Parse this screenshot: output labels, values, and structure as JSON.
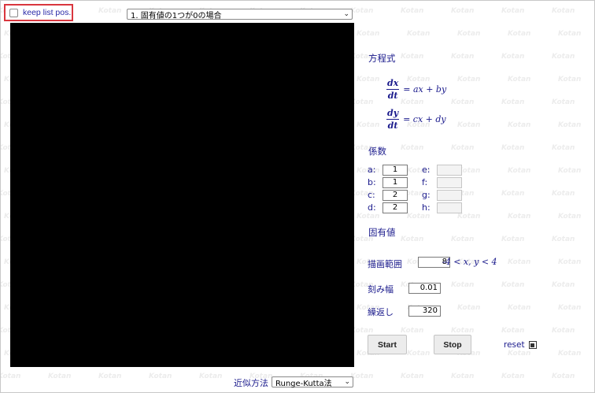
{
  "watermark": {
    "text": "Kotan"
  },
  "keep_list": {
    "label": "keep list pos.",
    "checked": false
  },
  "list_select": {
    "value": "1. 固有値の1つが0の場合"
  },
  "equations": {
    "heading": "方程式",
    "eq1": {
      "num": "dx",
      "den": "dt",
      "rhs": "= ax + by"
    },
    "eq2": {
      "num": "dy",
      "den": "dt",
      "rhs": "= cx + dy"
    }
  },
  "coefficients": {
    "heading": "係数",
    "labels": {
      "a": "a:",
      "b": "b:",
      "c": "c:",
      "d": "d:",
      "e": "e:",
      "f": "f:",
      "g": "g:",
      "h": "h:"
    },
    "values": {
      "a": "1",
      "b": "1",
      "c": "2",
      "d": "2",
      "e": "",
      "f": "",
      "g": "",
      "h": ""
    }
  },
  "eigen": {
    "heading": "固有値"
  },
  "range": {
    "label": "描画範囲",
    "value": "8",
    "text": "-4 < x, y < 4"
  },
  "step": {
    "label": "刻み幅",
    "value": "0.01"
  },
  "repeat": {
    "label": "繰返し",
    "value": "320"
  },
  "buttons": {
    "start": "Start",
    "stop": "Stop"
  },
  "reset": {
    "label": "reset",
    "checked": true
  },
  "method": {
    "label": "近似方法",
    "value": "Runge-Kutta法"
  },
  "colors": {
    "canvas": "#000000",
    "text": "#1a1a8c",
    "highlight_border": "#d9363e"
  }
}
